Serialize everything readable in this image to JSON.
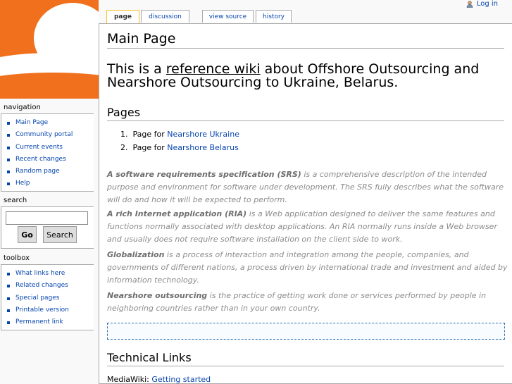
{
  "personal": {
    "login": "Log in"
  },
  "tabs": [
    {
      "label": "page",
      "selected": true
    },
    {
      "label": "discussion",
      "selected": false
    },
    {
      "label": "view source",
      "selected": false
    },
    {
      "label": "history",
      "selected": false
    }
  ],
  "navigation": {
    "title": "navigation",
    "items": [
      "Main Page",
      "Community portal",
      "Current events",
      "Recent changes",
      "Random page",
      "Help"
    ]
  },
  "search": {
    "title": "search",
    "value": "",
    "go": "Go",
    "search": "Search"
  },
  "toolbox": {
    "title": "toolbox",
    "items": [
      "What links here",
      "Related changes",
      "Special pages",
      "Printable version",
      "Permanent link"
    ]
  },
  "content": {
    "title": "Main Page",
    "intro": {
      "before": "This is a ",
      "link": "reference wiki",
      "after": " about Offshore Outsourcing and Nearshore Outsourcing to Ukraine, Belarus."
    },
    "pages_heading": "Pages",
    "pages": [
      {
        "num": "1.",
        "prefix": "Page for ",
        "link": "Nearshore Ukraine"
      },
      {
        "num": "2.",
        "prefix": "Page for ",
        "link": "Nearshore Belarus"
      }
    ],
    "paragraphs": [
      {
        "term": "A software requirements specification (SRS)",
        "text": " is a comprehensive description of the intended purpose and environment for software under development. The SRS fully describes what the software will do and how it will be expected to perform."
      },
      {
        "term": "A rich Internet application (RIA)",
        "text": " is a Web application designed to deliver the same features and functions normally associated with desktop applications. An RIA normally runs inside a Web browser and usually does not require software installation on the client side to work."
      },
      {
        "term": "Globalization",
        "text": " is a process of interaction and integration among the people, companies, and governments of different nations, a process driven by international trade and investment and aided by information technology."
      },
      {
        "term": "Nearshore outsourcing",
        "text": " is the practice of getting work done or services performed by people in neighboring countries rather than in your own country."
      }
    ],
    "tech_heading": "Technical Links",
    "mediawiki": {
      "prefix": "MediaWiki: ",
      "link": "Getting started"
    }
  }
}
